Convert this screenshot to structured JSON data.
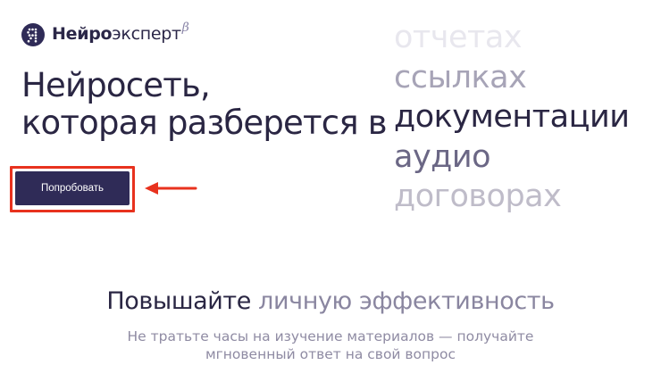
{
  "header": {
    "logo_icon": "ya-dotted-icon",
    "logo_strong": "Нейро",
    "logo_light": "эксперт",
    "logo_beta": "β"
  },
  "hero": {
    "title_line1": "Нейросеть,",
    "title_line2": "которая разберется в",
    "words": [
      "отчетах",
      "ссылках",
      "документации",
      "аудио",
      "договорах"
    ],
    "cta_label": "Попробовать",
    "highlight_color": "#e8321e",
    "arrow_icon": "left-arrow-icon"
  },
  "section": {
    "title_dark": "Повышайте ",
    "title_muted": "личную эффективность",
    "subtitle_line1": "Не тратьте часы на изучение материалов — получайте",
    "subtitle_line2": "мгновенный ответ на свой вопрос"
  },
  "colors": {
    "brand_dark": "#2f2b57",
    "text_dark": "#2a2643",
    "text_muted": "#8a86a0"
  }
}
